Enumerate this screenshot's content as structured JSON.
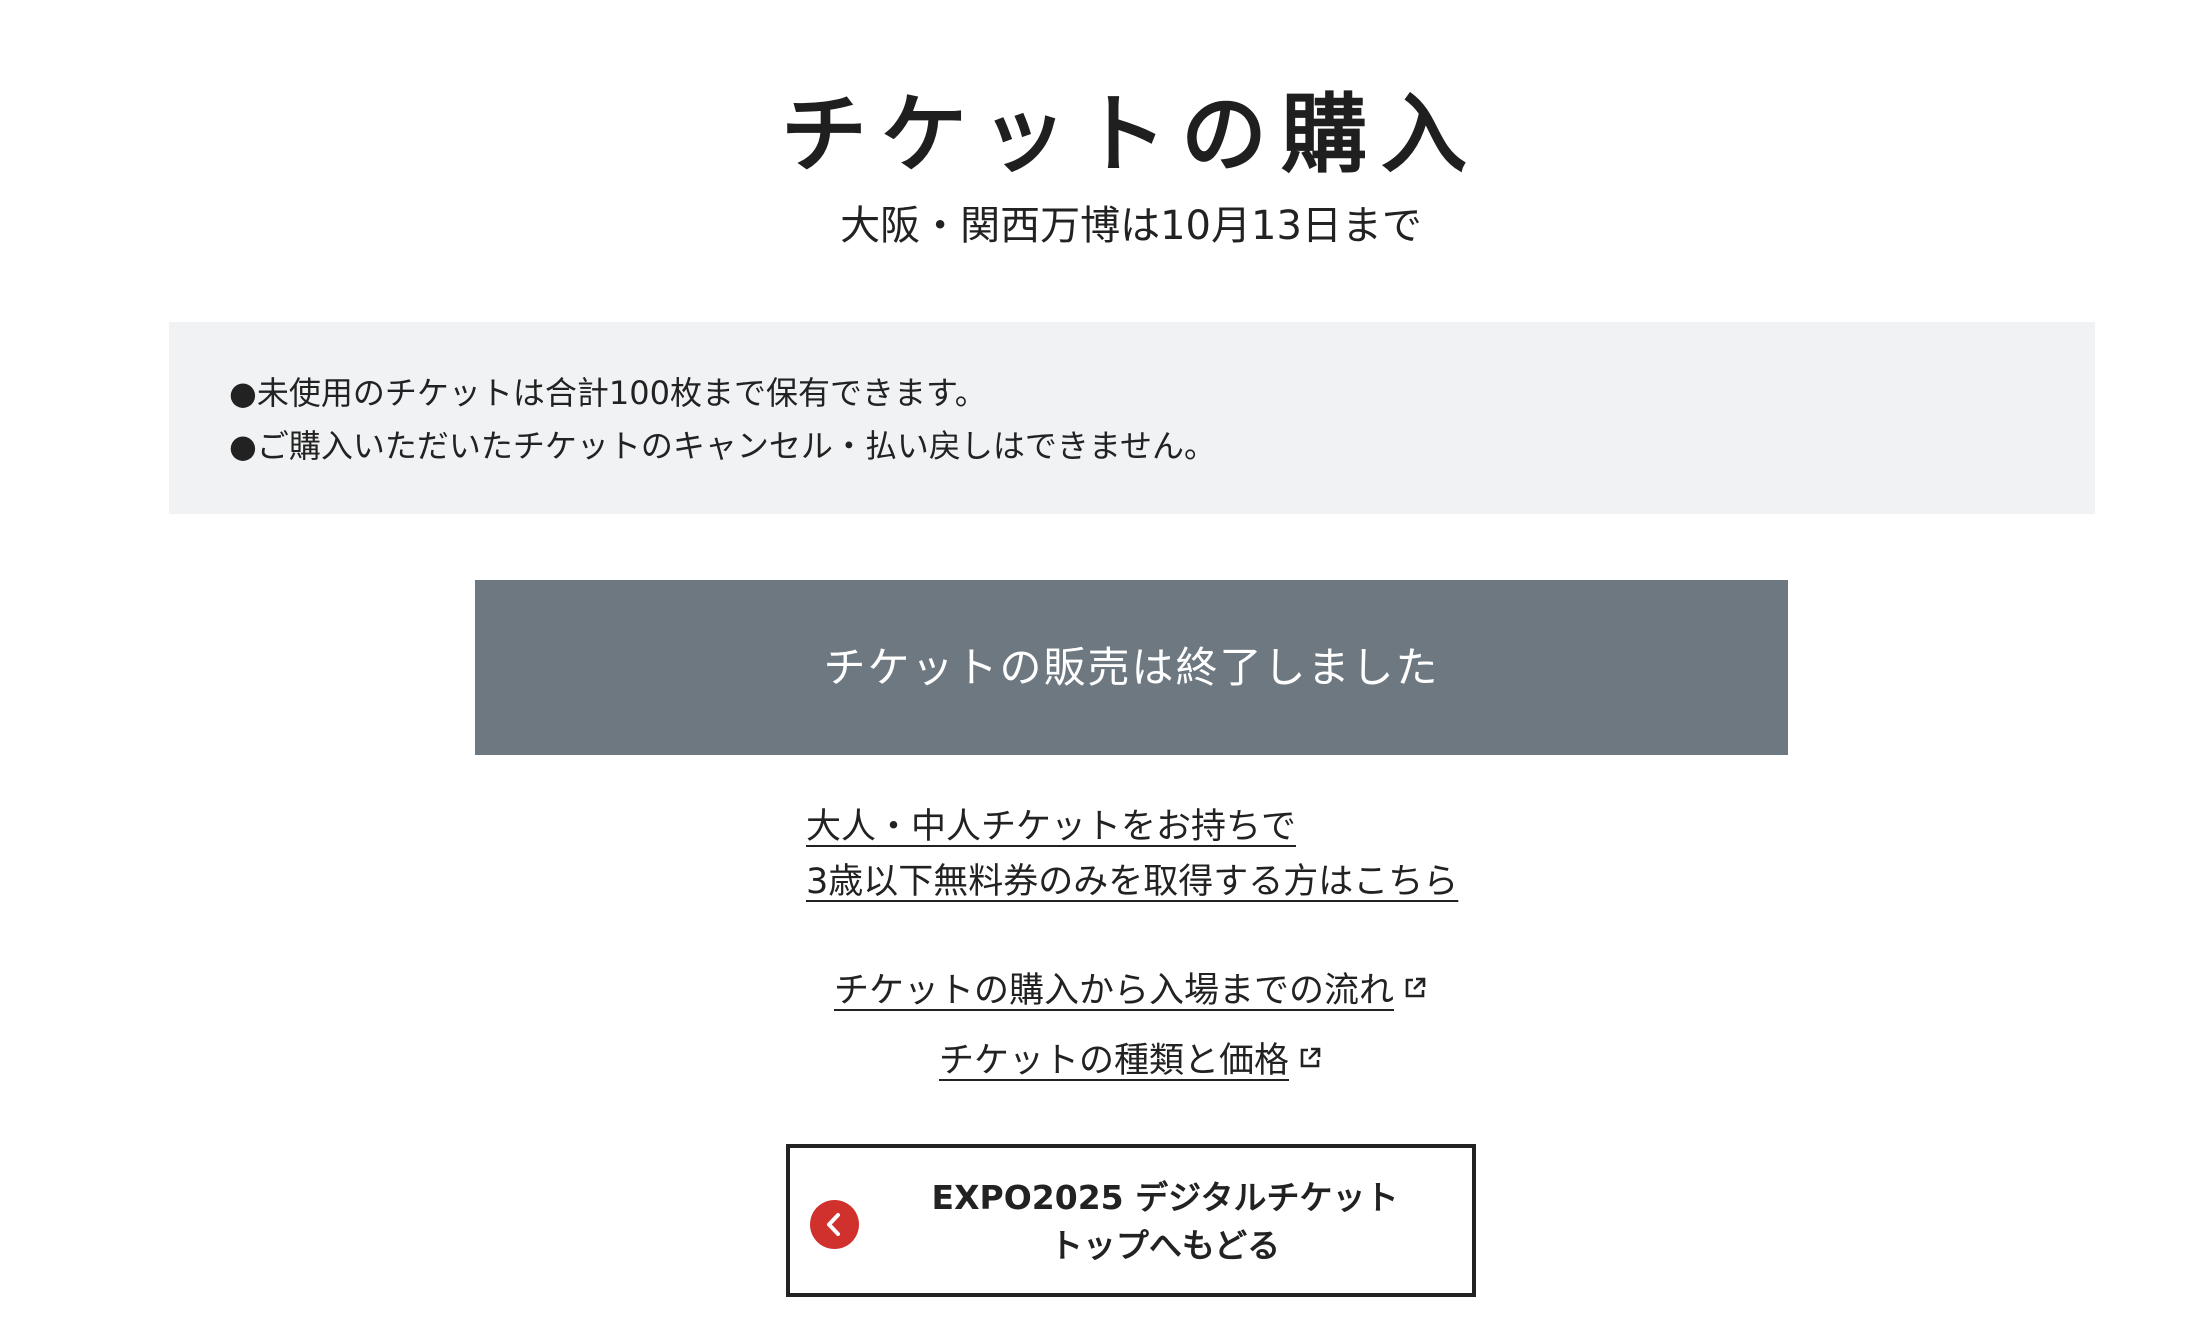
{
  "page": {
    "title": "チケットの購入",
    "subtitle": "大阪・関西万博は10月13日まで"
  },
  "notice": {
    "lines": [
      "●未使用のチケットは合計100枚まで保有できます。",
      "●ご購入いただいたチケットのキャンセル・払い戻しはできません。"
    ]
  },
  "status_banner": {
    "text": "チケットの販売は終了しました",
    "color": "#6e7881"
  },
  "free_ticket_link": {
    "line1": "大人・中人チケットをお持ちで",
    "line2": "3歳以下無料券のみを取得する方はこちら"
  },
  "info_links": [
    {
      "label": "チケットの購入から入場までの流れ",
      "icon": "external-link-icon"
    },
    {
      "label": "チケットの種類と価格",
      "icon": "external-link-icon"
    }
  ],
  "back_button": {
    "line1": "EXPO2025 デジタルチケット",
    "line2": "トップへもどる",
    "icon": "chevron-left-icon",
    "accent_color": "#d0312d"
  }
}
